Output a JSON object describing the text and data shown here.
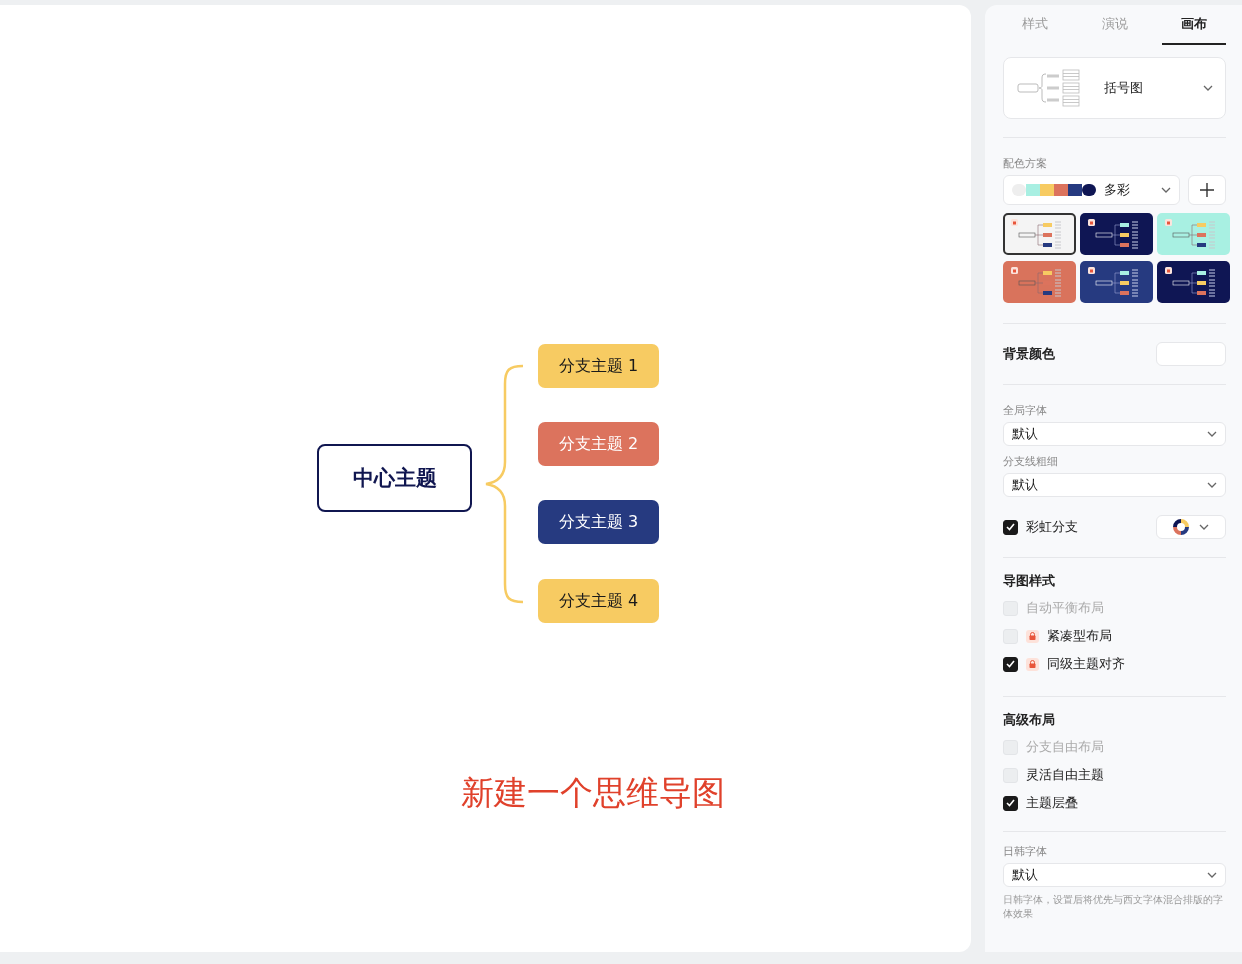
{
  "canvas": {
    "center_topic": "中心主题",
    "branches": [
      {
        "label": "分支主题 1",
        "color": "#f7cb62"
      },
      {
        "label": "分支主题 2",
        "color": "#dc735d"
      },
      {
        "label": "分支主题 3",
        "color": "#263a80"
      },
      {
        "label": "分支主题 4",
        "color": "#f7cb62"
      }
    ],
    "caption": "新建一个思维导图"
  },
  "panel": {
    "tabs": [
      {
        "label": "样式",
        "selected": false
      },
      {
        "label": "演说",
        "selected": false
      },
      {
        "label": "画布",
        "selected": true
      }
    ],
    "structure": {
      "value": "括号图"
    },
    "color_scheme": {
      "label": "配色方案",
      "value": "多彩",
      "swatches": [
        {
          "color": "#eeeeee"
        },
        {
          "color": "#a8efe2"
        },
        {
          "color": "#f7cb62"
        },
        {
          "color": "#dc735d"
        },
        {
          "color": "#263a80"
        },
        {
          "color": "#0f1654"
        }
      ],
      "themes": [
        {
          "color": "#f4f4f4",
          "selected": true
        },
        {
          "color": "#0f1654",
          "selected": false
        },
        {
          "color": "#a8f0e2",
          "selected": false
        },
        {
          "color": "#d9735c",
          "selected": false
        },
        {
          "color": "#263a80",
          "selected": false
        },
        {
          "color": "#0f1654",
          "selected": false
        }
      ]
    },
    "background": {
      "label": "背景颜色",
      "color": "#ffffff"
    },
    "global_font": {
      "label": "全局字体",
      "value": "默认"
    },
    "line_width": {
      "label": "分支线粗细",
      "value": "默认"
    },
    "rainbow": {
      "label": "彩虹分支",
      "checked": true
    },
    "sections": [
      {
        "title": "导图样式",
        "options": [
          {
            "label": "自动平衡布局",
            "checked": false,
            "disabled": true,
            "locked": false
          },
          {
            "label": "紧凑型布局",
            "checked": false,
            "disabled": false,
            "locked": true
          },
          {
            "label": "同级主题对齐",
            "checked": true,
            "disabled": false,
            "locked": true
          }
        ]
      },
      {
        "title": "高级布局",
        "options": [
          {
            "label": "分支自由布局",
            "checked": false,
            "disabled": true,
            "locked": false
          },
          {
            "label": "灵活自由主题",
            "checked": false,
            "disabled": false,
            "locked": false
          },
          {
            "label": "主题层叠",
            "checked": true,
            "disabled": false,
            "locked": false
          }
        ]
      }
    ],
    "cjk_font": {
      "label": "日韩字体",
      "value": "默认",
      "hint": "日韩字体，设置后将优先与西文字体混合排版的字体效果"
    }
  }
}
